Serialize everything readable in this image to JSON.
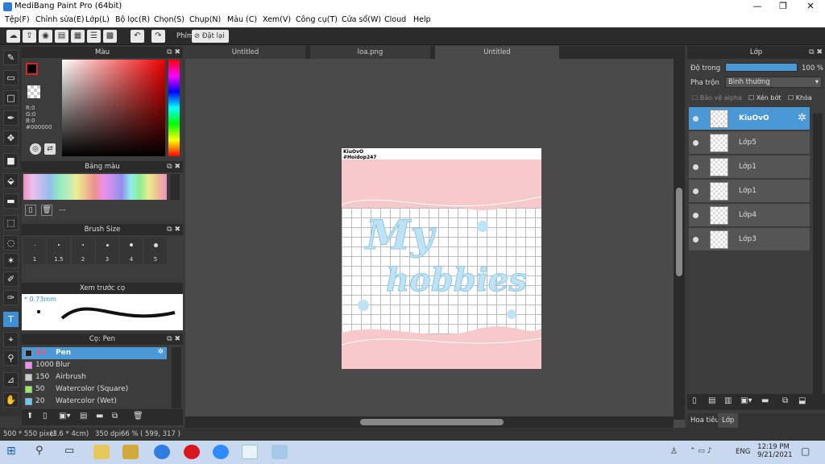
{
  "window": {
    "title": "MediBang Paint Pro (64bit)"
  },
  "menu": [
    "Tệp(F)",
    "Chỉnh sửa(E)",
    "Lớp(L)",
    "Bộ lọc(R)",
    "Chọn(S)",
    "Chụp(N)",
    "Màu (C)",
    "Xem(V)",
    "Công cụ(T)",
    "Cửa sổ(W)",
    "Cloud",
    "Help"
  ],
  "toolbar": {
    "phim": "Phím",
    "reset": "Đặt lại"
  },
  "color_panel": {
    "title": "Màu",
    "r": "R:0",
    "g": "G:0",
    "b": "B:0",
    "hex": "#000000",
    "primary": "#000000",
    "secondary": "#cc44dd"
  },
  "palette_panel": {
    "title": "Bảng màu",
    "dash": "---"
  },
  "brushsize_panel": {
    "title": "Brush Size",
    "sizes": [
      "1",
      "1.5",
      "2",
      "3",
      "4",
      "5"
    ]
  },
  "preview_panel": {
    "title": "Xem trước cọ",
    "size": "0.73mm"
  },
  "brush_panel": {
    "title": "Cọ: Pen",
    "items": [
      {
        "size": "10",
        "name": "Pen",
        "color": "#222222",
        "selected": true
      },
      {
        "size": "1000",
        "name": "Blur",
        "color": "#ff88ff"
      },
      {
        "size": "150",
        "name": "Airbrush",
        "color": "#cccccc"
      },
      {
        "size": "50",
        "name": "Watercolor (Square)",
        "color": "#99ee55"
      },
      {
        "size": "20",
        "name": "Watercolor (Wet)",
        "color": "#66ccff"
      }
    ]
  },
  "tabs": [
    "Untitled",
    "loa.png",
    "Untitled"
  ],
  "canvas": {
    "header_line1": "KiuOvO",
    "header_line2": "#Hoidop247",
    "text1": "My",
    "text2": "hobbies"
  },
  "layers_panel": {
    "title": "Lớp",
    "opacity_label": "Độ trong",
    "opacity_value": "100 %",
    "blend_label": "Pha trộn",
    "blend_value": "Bình thường",
    "opt_alpha": "Bảo vệ alpha",
    "opt_clip": "Xén bớt",
    "opt_lock": "Khóa",
    "layers": [
      {
        "name": "KiuOvO",
        "selected": true
      },
      {
        "name": "Lớp5"
      },
      {
        "name": "Lớp1"
      },
      {
        "name": "Lớp1"
      },
      {
        "name": "Lớp4"
      },
      {
        "name": "Lớp3"
      }
    ],
    "bottom_tabs": [
      "Hoa tiêu",
      "Lớp"
    ]
  },
  "status": {
    "size": "500 * 550 pixel",
    "cm": "(3.6 * 4cm)",
    "dpi": "350 dpi",
    "zoom": "66 %",
    "coords": "( 599, 317 )"
  },
  "taskbar": {
    "time": "12:19 PM",
    "date": "9/21/2021",
    "lang": "ENG"
  }
}
